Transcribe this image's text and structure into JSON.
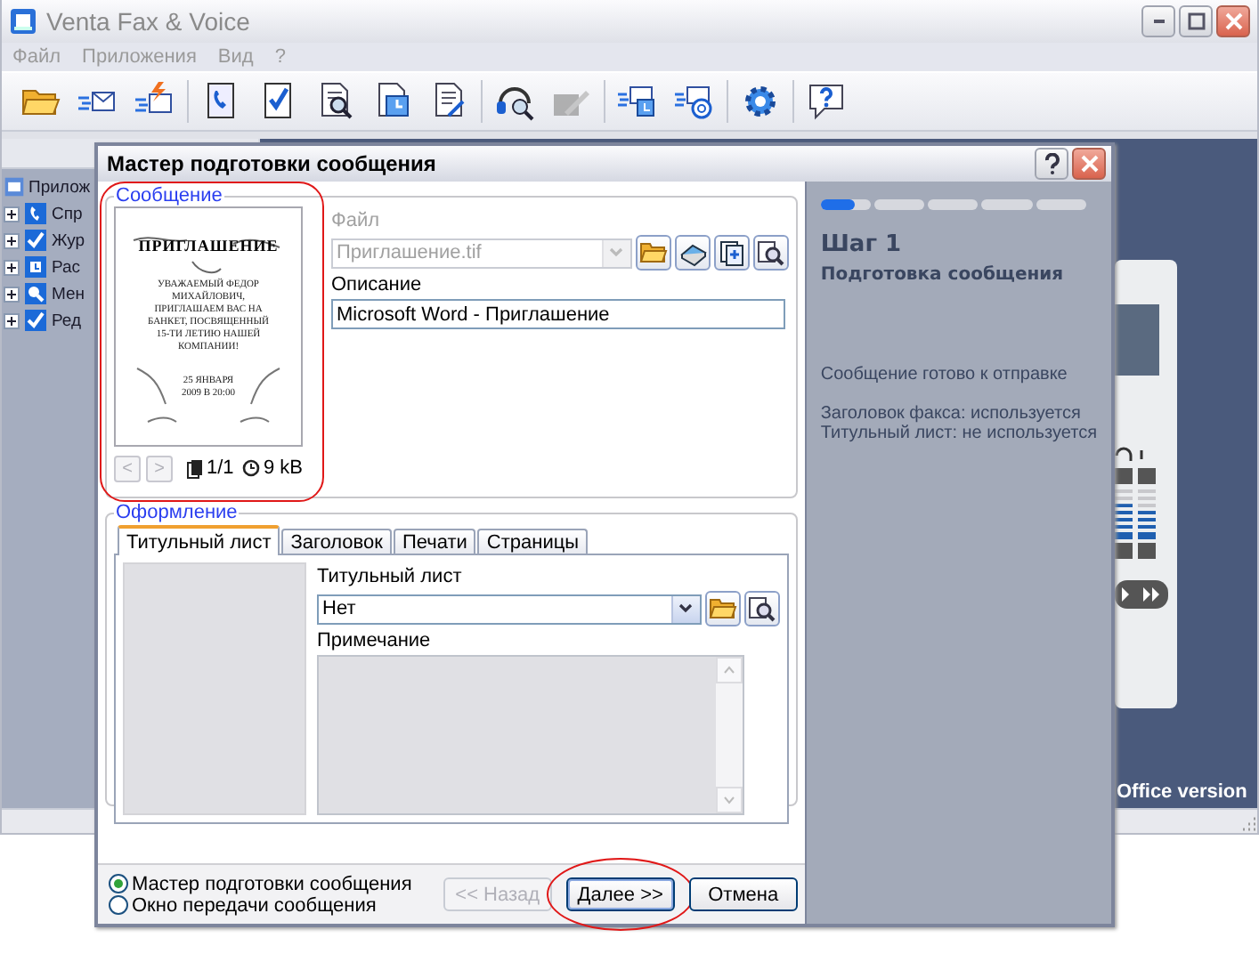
{
  "window": {
    "title": "Venta Fax & Voice"
  },
  "menu": [
    {
      "label": "Файл"
    },
    {
      "label": "Приложения"
    },
    {
      "label": "Вид"
    },
    {
      "label": "?"
    }
  ],
  "toolbar": {
    "groups": [
      {
        "items": [
          {
            "kind": "open",
            "disabled": false
          },
          {
            "kind": "send_fax",
            "disabled": false
          },
          {
            "kind": "send_quick",
            "disabled": false
          }
        ]
      },
      {
        "items": [
          {
            "kind": "phone_doc",
            "disabled": false
          },
          {
            "kind": "check_doc",
            "disabled": false
          },
          {
            "kind": "search_doc",
            "disabled": false
          },
          {
            "kind": "calendar_doc",
            "disabled": false
          },
          {
            "kind": "edit_doc",
            "disabled": false
          }
        ]
      },
      {
        "items": [
          {
            "kind": "headset",
            "disabled": false
          },
          {
            "kind": "signature",
            "disabled": true
          }
        ]
      },
      {
        "items": [
          {
            "kind": "schedule",
            "disabled": false
          },
          {
            "kind": "email",
            "disabled": false
          }
        ]
      },
      {
        "items": [
          {
            "kind": "settings",
            "disabled": false
          }
        ]
      },
      {
        "items": [
          {
            "kind": "help",
            "disabled": false
          }
        ]
      }
    ]
  },
  "tree": {
    "label": "Прилож",
    "children": [
      {
        "label": "Спр",
        "kind": "phone",
        "expanded": false
      },
      {
        "label": "Жур",
        "kind": "check",
        "expanded": false
      },
      {
        "label": "Рас",
        "kind": "calendar",
        "expanded": false
      },
      {
        "label": "Мен",
        "kind": "search",
        "expanded": false
      },
      {
        "label": "Ред",
        "kind": "check",
        "expanded": false
      }
    ]
  },
  "device": {
    "meters": [
      {
        "level": 0.71
      },
      {
        "level": 0.57
      }
    ],
    "caption": "Office version"
  },
  "dialog": {
    "title": "Мастер подготовки сообщения",
    "message_group": {
      "label": "Сообщение",
      "highlighted": true,
      "preview": {
        "heading": "ПРИГЛАШЕНИЕ",
        "body": "УВАЖАЕМЫЙ ФЕДОР МИХАЙЛОВИЧ, ПРИГЛАШАЕМ ВАС НА БАНКЕТ, ПОСВЯЩЕННЫЙ 15-ТИ ЛЕТИЮ НАШЕЙ КОМПАНИИ!",
        "footer": "25 ЯНВАРЯ 2009 В 20:00"
      },
      "nav_buttons": [
        {
          "label": "<",
          "disabled": true
        },
        {
          "label": ">",
          "disabled": true
        }
      ],
      "pages": "1/1",
      "size": "9 kB",
      "file_label": "Файл",
      "file": {
        "value": "Приглашение.tif",
        "disabled": true
      },
      "file_actions": [
        {
          "kind": "open"
        },
        {
          "kind": "scan"
        },
        {
          "kind": "pages"
        },
        {
          "kind": "preview"
        }
      ],
      "description_label": "Описание",
      "description": "Microsoft Word - Приглашение"
    },
    "design_group": {
      "label": "Оформление",
      "tabs": [
        {
          "label": "Титульный лист",
          "selected": true
        },
        {
          "label": "Заголовок",
          "selected": false
        },
        {
          "label": "Печати",
          "selected": false
        },
        {
          "label": "Страницы",
          "selected": false
        }
      ],
      "cover_label": "Титульный лист",
      "cover": "Нет",
      "cover_actions": [
        {
          "kind": "open"
        },
        {
          "kind": "preview"
        }
      ],
      "note_label": "Примечание",
      "note_disabled": true
    },
    "mode_options": [
      {
        "label": "Мастер подготовки сообщения",
        "selected": true
      },
      {
        "label": "Окно передачи сообщения",
        "selected": false
      }
    ],
    "buttons": [
      {
        "label": "<< Назад",
        "disabled": true,
        "highlighted": false
      },
      {
        "label": "Далее >>",
        "disabled": false,
        "highlighted": true
      },
      {
        "label": "Отмена",
        "disabled": false,
        "highlighted": false
      }
    ],
    "steps": {
      "level": 0.13,
      "title": "Шаг 1",
      "subtitle": "Подготовка сообщения",
      "status": "Сообщение готово к отправке",
      "details": [
        "Заголовок факса: используется",
        "Титульный лист: не используется"
      ]
    }
  }
}
